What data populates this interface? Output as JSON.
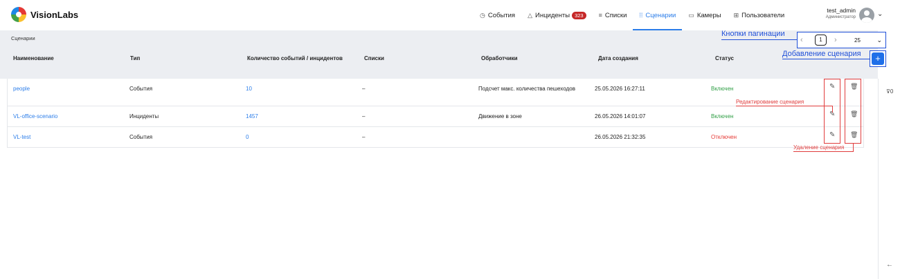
{
  "app": {
    "logo_text": "VisionLabs"
  },
  "nav": [
    {
      "icon": "◷",
      "label": "События"
    },
    {
      "icon": "△",
      "label": "Инциденты",
      "badge": "323"
    },
    {
      "icon": "≡",
      "label": "Списки"
    },
    {
      "icon": "⁞⁞",
      "label": "Сценарии",
      "active": true
    },
    {
      "icon": "▭",
      "label": "Камеры"
    },
    {
      "icon": "⊞",
      "label": "Пользователи"
    }
  ],
  "user": {
    "name": "test_admin",
    "role": "Администратор"
  },
  "breadcrumb": "Сценарии",
  "columns": [
    "Наименование",
    "Тип",
    "Количество событий / инцидентов",
    "Списки",
    "Обработчики",
    "Дата создания",
    "Статус"
  ],
  "pagination": {
    "prev": "‹",
    "page": "1",
    "next": "›",
    "page_size": "25",
    "chevron": "⌄"
  },
  "add_button": "+",
  "rows": [
    {
      "name": "people",
      "type": "События",
      "count": "10",
      "lists": "–",
      "handler": "Подсчет макс. количества пешеходов",
      "created": "25.05.2026 16:27:11",
      "status": "Включен",
      "status_color": "#2e9e44"
    },
    {
      "name": "VL-office-scenario",
      "type": "Инциденты",
      "count": "1457",
      "lists": "–",
      "handler": "Движение в зоне",
      "created": "26.05.2026 14:01:07",
      "status": "Включен",
      "status_color": "#2e9e44"
    },
    {
      "name": "VL-test",
      "type": "События",
      "count": "0",
      "lists": "–",
      "handler": "",
      "created": "26.05.2026 21:32:35",
      "status": "Отключен",
      "status_color": "#e53935"
    }
  ],
  "actions": {
    "edit_icon": "✎",
    "delete_icon": "🗑"
  },
  "annotations": {
    "pagination": "Кнопки пагинации",
    "add": "Добавление сценария",
    "edit": "Редактирование сценария",
    "delete": "Удаление сценария"
  },
  "filter": {
    "icon": "⊽",
    "count": "0"
  },
  "collapse_icon": "←"
}
